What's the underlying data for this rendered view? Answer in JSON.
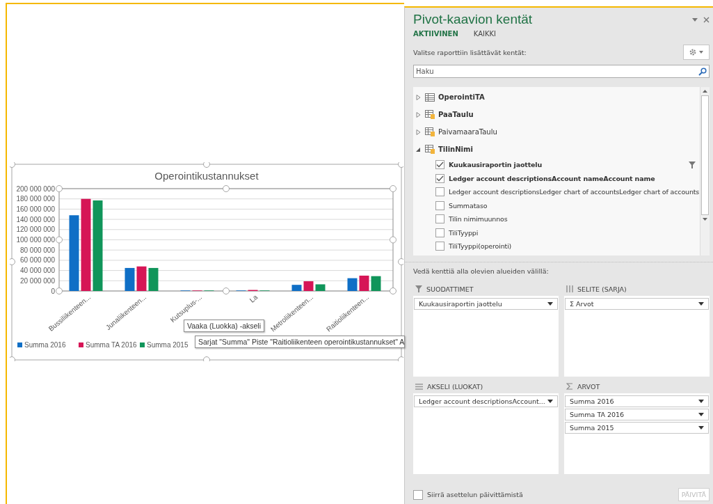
{
  "chart": {
    "tooltip_axis": "Vaaka (Luokka)  -akseli",
    "tooltip_series": "Sarjat \"Summa\" Piste \"Raitioliikenteen operointikustannukset\" A",
    "chart_data": {
      "type": "bar",
      "title": "Operointikustannukset",
      "categories": [
        "Bussiliikenteen...",
        "Junaliikenteen...",
        "Kutsuplus-...",
        "La",
        "Metroliikenteen...",
        "Raitioliikenteen..."
      ],
      "series": [
        {
          "name": "Summa 2016",
          "color": "#0f6fc6",
          "values": [
            148000000,
            45000000,
            1000000,
            1000000,
            12000000,
            25000000
          ]
        },
        {
          "name": "Summa TA 2016",
          "color": "#d61556",
          "values": [
            180000000,
            48000000,
            1000000,
            2000000,
            19000000,
            30000000
          ]
        },
        {
          "name": "Summa 2015",
          "color": "#10955a",
          "values": [
            177000000,
            45000000,
            1000000,
            1000000,
            13000000,
            29000000
          ]
        }
      ],
      "grid": true,
      "legend": true,
      "ylim": [
        0,
        200000000
      ],
      "yticks": [
        {
          "value": 0,
          "label": "0"
        },
        {
          "value": 20000000,
          "label": "20 000 000"
        },
        {
          "value": 40000000,
          "label": "40 000 000"
        },
        {
          "value": 60000000,
          "label": "60 000 000"
        },
        {
          "value": 80000000,
          "label": "80 000 000"
        },
        {
          "value": 100000000,
          "label": "100 000 000"
        },
        {
          "value": 120000000,
          "label": "120 000 000"
        },
        {
          "value": 140000000,
          "label": "140 000 000"
        },
        {
          "value": 160000000,
          "label": "160 000 000"
        },
        {
          "value": 180000000,
          "label": "180 000 000"
        },
        {
          "value": 200000000,
          "label": "200 000 000"
        }
      ]
    }
  },
  "panel": {
    "title": "Pivot-kaavion kentät",
    "tabs": [
      {
        "label": "AKTIIVINEN",
        "selected": true
      },
      {
        "label": "KAIKKI",
        "selected": false
      }
    ],
    "choose_label": "Valitse raporttiin lisättävät kentät:",
    "search": {
      "placeholder": "Haku"
    },
    "tables": [
      {
        "name": "OperointiTA",
        "kind": "table",
        "active": true,
        "expanded": false
      },
      {
        "name": "PaaTaulu",
        "kind": "linked",
        "active": true,
        "expanded": false
      },
      {
        "name": "PaivamaaraTaulu",
        "kind": "linked",
        "active": false,
        "expanded": false
      },
      {
        "name": "TilinNimi",
        "kind": "linked",
        "active": true,
        "expanded": true,
        "fields": [
          {
            "label": "Kuukausiraportin jaottelu",
            "checked": true,
            "filtered": true
          },
          {
            "label": "Ledger account descriptionsAccount nameAccount name",
            "checked": true,
            "filtered": false
          },
          {
            "label": "Ledger account descriptionsLedger chart of accountsLedger chart of accounts",
            "checked": false,
            "filtered": false
          },
          {
            "label": "Summataso",
            "checked": false,
            "filtered": false
          },
          {
            "label": "Tilin nimimuunnos",
            "checked": false,
            "filtered": false
          },
          {
            "label": "TiliTyyppi",
            "checked": false,
            "filtered": false
          },
          {
            "label": "TiliTyyppi(operointi)",
            "checked": false,
            "filtered": false
          }
        ]
      }
    ],
    "drag_label": "Vedä kenttiä alla olevien alueiden välillä:",
    "areas": [
      {
        "kind": "filter",
        "title": "SUODATTIMET",
        "items": [
          "Kuukausiraportin jaottelu"
        ]
      },
      {
        "kind": "legend",
        "title": "SELITE (SARJA)",
        "items": [
          "Σ Arvot"
        ]
      },
      {
        "kind": "axis",
        "title": "AKSELI (LUOKAT)",
        "items": [
          "Ledger account descriptionsAccount..."
        ]
      },
      {
        "kind": "values",
        "title": "ARVOT",
        "items": [
          "Summa 2016",
          "Summa TA 2016",
          "Summa 2015"
        ]
      }
    ],
    "defer": {
      "label": "Siirrä asettelun päivittämistä",
      "checked": false
    },
    "update_button": {
      "label": "PÄIVITÄ",
      "disabled": true
    }
  }
}
